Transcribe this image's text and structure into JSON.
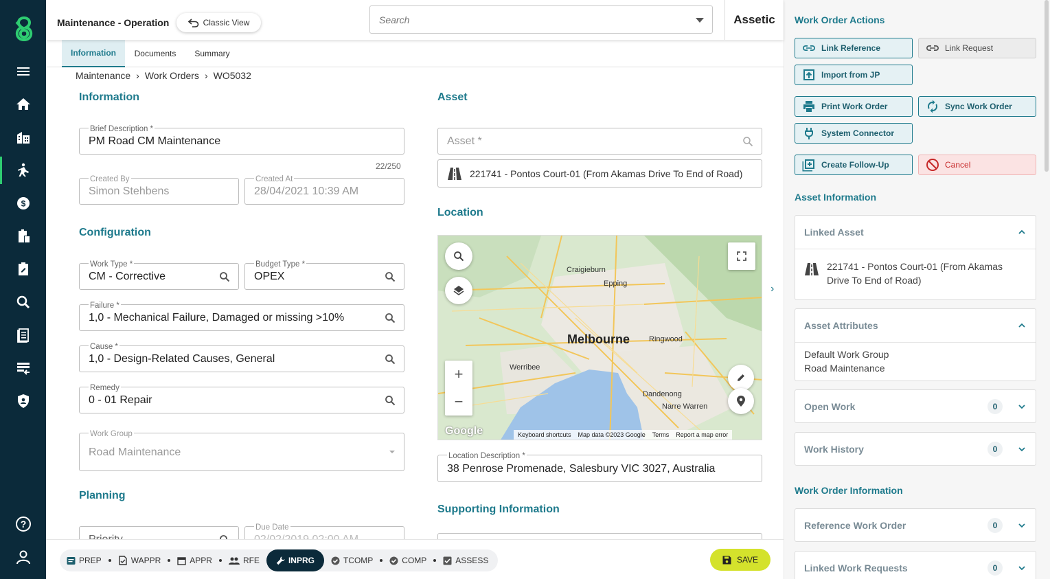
{
  "header": {
    "title": "Maintenance - Operation",
    "classic_view": "Classic View",
    "search_placeholder": "Search",
    "brand": "Assetic"
  },
  "tabs": [
    "Information",
    "Documents",
    "Summary"
  ],
  "breadcrumb": [
    "Maintenance",
    "Work Orders",
    "WO5032"
  ],
  "information": {
    "title": "Information",
    "brief_description": {
      "label": "Brief Description *",
      "value": "PM Road CM Maintenance",
      "counter": "22/250"
    },
    "created_by": {
      "label": "Created By",
      "value": "Simon Stehbens"
    },
    "created_at": {
      "label": "Created At",
      "value": "28/04/2021 10:39 AM"
    }
  },
  "configuration": {
    "title": "Configuration",
    "work_type": {
      "label": "Work Type *",
      "value": "CM - Corrective"
    },
    "budget_type": {
      "label": "Budget Type *",
      "value": "OPEX"
    },
    "failure": {
      "label": "Failure *",
      "value": "1,0 - Mechanical Failure, Damaged or missing  >10%"
    },
    "cause": {
      "label": "Cause *",
      "value": "1,0 - Design-Related Causes, General"
    },
    "remedy": {
      "label": "Remedy",
      "value": "0 - 01 Repair"
    },
    "work_group": {
      "label": "Work Group",
      "value": "Road Maintenance"
    }
  },
  "planning": {
    "title": "Planning",
    "priority": {
      "label": "Priority"
    },
    "due_date": {
      "label": "Due Date",
      "value": "02/02/2019 02:00 AM"
    }
  },
  "asset": {
    "title": "Asset",
    "asset_label": "Asset *",
    "selected": "221741 - Pontos Court-01 (From Akamas Drive To End of Road)"
  },
  "location": {
    "title": "Location",
    "map_labels": {
      "city": "Melbourne",
      "suburbs": [
        "Craigieburn",
        "Epping",
        "Ringwood",
        "Werribee",
        "Dandenong",
        "Narre Warren"
      ]
    },
    "map_footer": [
      "Keyboard shortcuts",
      "Map data ©2023 Google",
      "Terms",
      "Report a map error"
    ],
    "google": "Google",
    "description": {
      "label": "Location Description *",
      "value": "38 Penrose Promenade, Salesbury VIC 3027, Australia"
    }
  },
  "supporting": {
    "title": "Supporting Information"
  },
  "status_steps": [
    "PREP",
    "WAPPR",
    "APPR",
    "RFE",
    "INPRG",
    "TCOMP",
    "COMP",
    "ASSESS"
  ],
  "active_step": "INPRG",
  "save_label": "SAVE",
  "actions": {
    "title": "Work Order Actions",
    "link_reference": "Link Reference",
    "link_request": "Link Request",
    "import_jp": "Import from JP",
    "print": "Print Work Order",
    "sync": "Sync Work Order",
    "system_connector": "System Connector",
    "follow_up": "Create Follow-Up",
    "cancel": "Cancel"
  },
  "asset_info": {
    "title": "Asset Information",
    "linked_asset": {
      "title": "Linked Asset",
      "line1": "221741 - Pontos Court-01 (From Akamas",
      "line2": "Drive To End of Road)"
    },
    "attributes": {
      "title": "Asset Attributes",
      "key": "Default Work Group",
      "value": "Road Maintenance"
    },
    "open_work": {
      "title": "Open Work",
      "count": "0"
    },
    "work_history": {
      "title": "Work History",
      "count": "0"
    }
  },
  "wo_info": {
    "title": "Work Order Information",
    "reference": {
      "title": "Reference Work Order",
      "count": "0"
    },
    "linked_requests": {
      "title": "Linked Work Requests",
      "count": "0"
    }
  },
  "colors": {
    "sidebar": "#0b2a3a",
    "accent": "#1e7a8c",
    "save": "#d4e22c",
    "cancel": "#c62828"
  }
}
